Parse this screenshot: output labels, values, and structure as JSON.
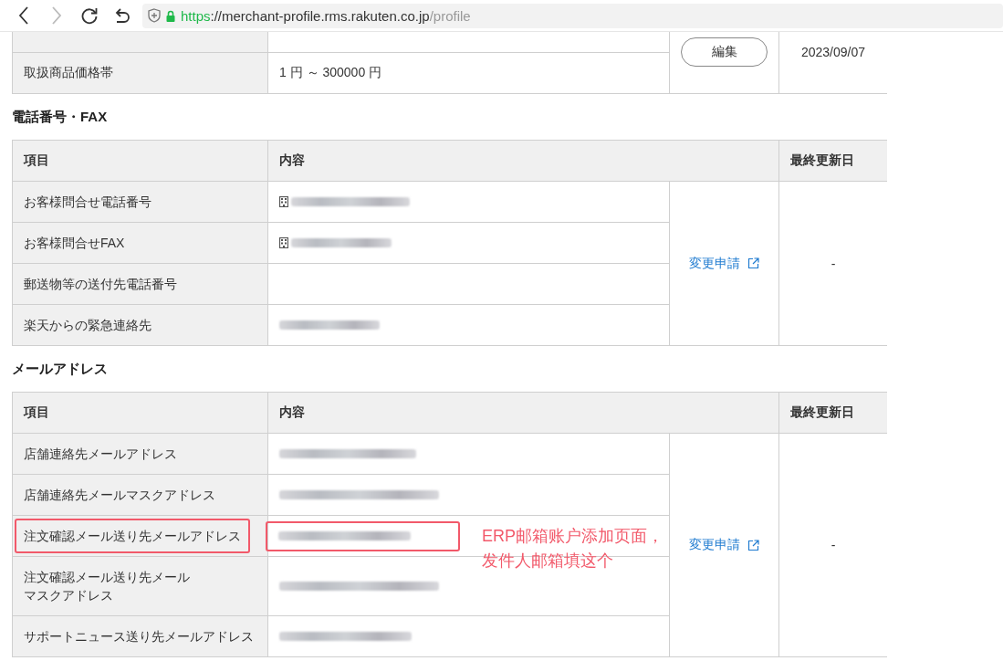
{
  "browser": {
    "url": {
      "scheme": "https",
      "host": "://merchant-profile.rms.rakuten.co.jp",
      "path": "/profile"
    },
    "back_enabled": true,
    "forward_enabled": false
  },
  "top_table": {
    "clipped_row": true,
    "rows": [
      {
        "label": "取扱商品価格帯",
        "value": "1 円 ～ 300000 円"
      }
    ],
    "action": "編集",
    "updated": "2023/09/07"
  },
  "sections": [
    {
      "title": "電話番号・FAX",
      "columns": [
        "項目",
        "内容",
        "最終更新日"
      ],
      "rows": [
        {
          "label": "お客様問合せ電話番号",
          "kind": "phone",
          "highlighted": false
        },
        {
          "label": "お客様問合せFAX",
          "kind": "phone",
          "highlighted": false
        },
        {
          "label": "郵送物等の送付先電話番号",
          "kind": "empty",
          "highlighted": false
        },
        {
          "label": "楽天からの緊急連絡先",
          "kind": "hidden",
          "highlighted": false
        }
      ],
      "action": "変更申請",
      "updated": "-"
    },
    {
      "title": "メールアドレス",
      "columns": [
        "項目",
        "内容",
        "最終更新日"
      ],
      "rows": [
        {
          "label": "店舗連絡先メールアドレス",
          "kind": "hidden",
          "highlighted": false
        },
        {
          "label": "店舗連絡先メールマスクアドレス",
          "kind": "hidden",
          "highlighted": false
        },
        {
          "label": "注文確認メール送り先メールアドレス",
          "kind": "hidden",
          "highlighted": true,
          "note": [
            "ERP邮箱账户添加页面，",
            "发件人邮箱填这个"
          ]
        },
        {
          "label": [
            "注文確認メール送り先メール",
            "マスクアドレス"
          ],
          "kind": "hidden",
          "highlighted": false
        },
        {
          "label": "サポートニュース送り先メールアドレス",
          "kind": "hidden",
          "highlighted": false
        }
      ],
      "action": "変更申請",
      "updated": "-"
    }
  ]
}
